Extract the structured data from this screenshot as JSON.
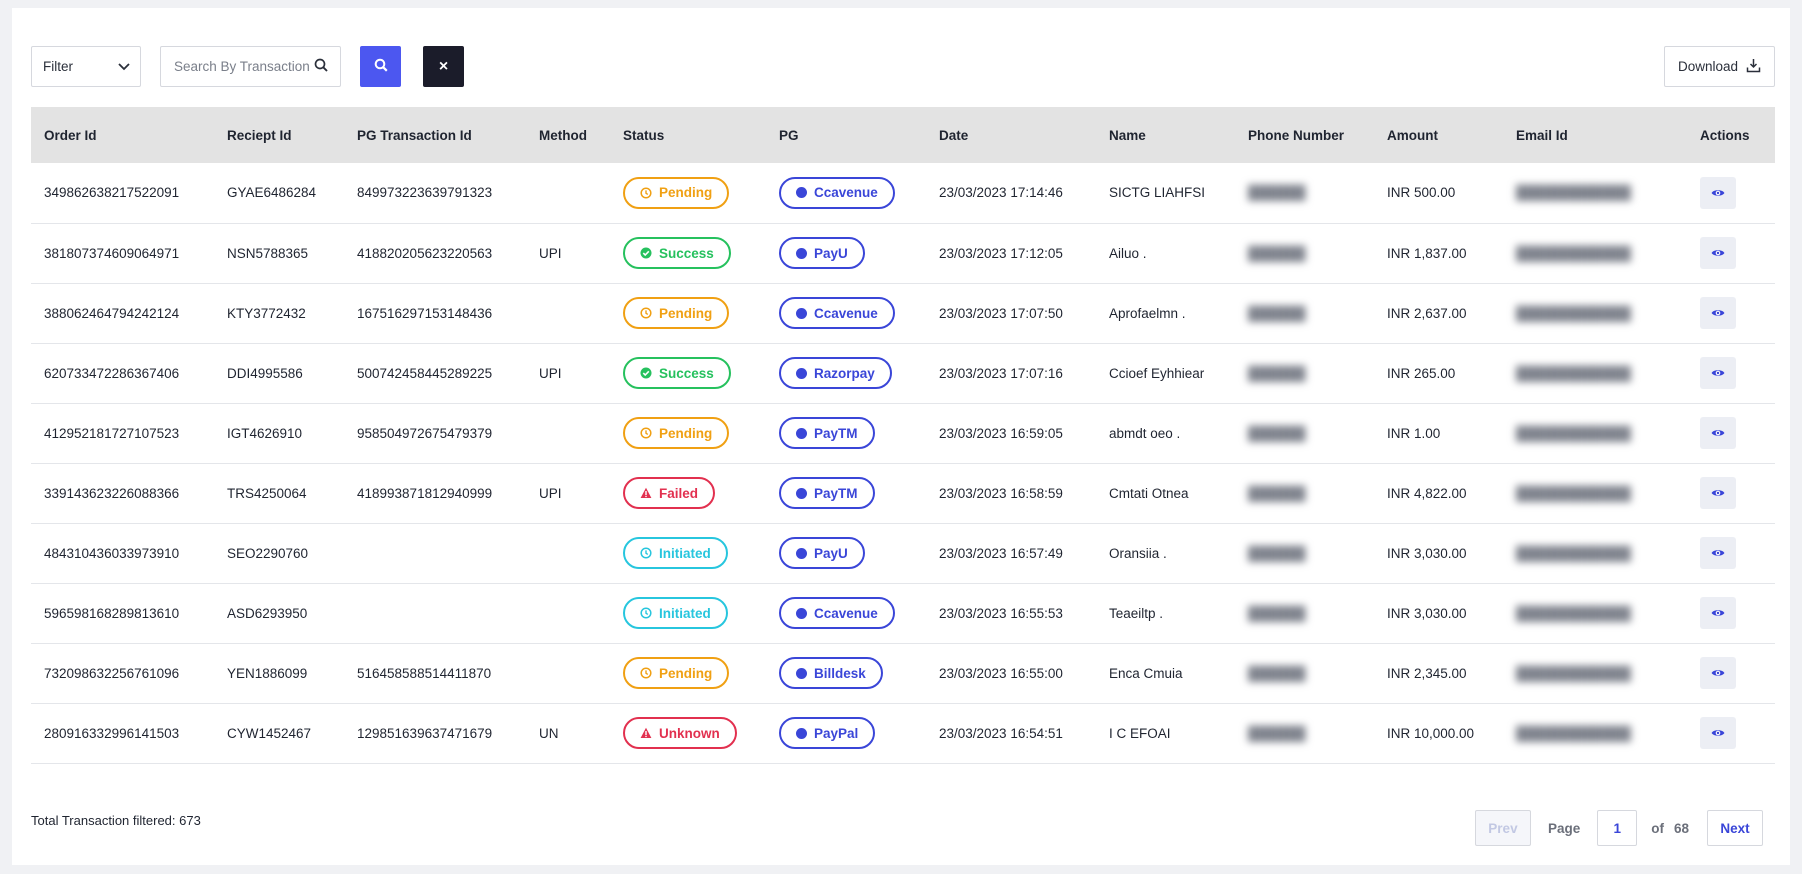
{
  "toolbar": {
    "filter_label": "Filter",
    "search_placeholder": "Search By Transaction",
    "clear_label": "×",
    "download_label": "Download"
  },
  "table": {
    "columns": [
      "Order Id",
      "Reciept Id",
      "PG Transaction Id",
      "Method",
      "Status",
      "PG",
      "Date",
      "Name",
      "Phone Number",
      "Amount",
      "Email Id",
      "Actions"
    ],
    "rows": [
      {
        "order_id": "349862638217522091",
        "receipt_id": "GYAE6486284",
        "pg_txn_id": "849973223639791323",
        "method": "",
        "status": "Pending",
        "status_kind": "pending",
        "pg": "Ccavenue",
        "date": "23/03/2023 17:14:46",
        "name": "SICTG LIAHFSI",
        "amount": "INR 500.00"
      },
      {
        "order_id": "381807374609064971",
        "receipt_id": "NSN5788365",
        "pg_txn_id": "418820205623220563",
        "method": "UPI",
        "status": "Success",
        "status_kind": "success",
        "pg": "PayU",
        "date": "23/03/2023 17:12:05",
        "name": "Ailuo .",
        "amount": "INR 1,837.00"
      },
      {
        "order_id": "388062464794242124",
        "receipt_id": "KTY3772432",
        "pg_txn_id": "167516297153148436",
        "method": "",
        "status": "Pending",
        "status_kind": "pending",
        "pg": "Ccavenue",
        "date": "23/03/2023 17:07:50",
        "name": "Aprofaelmn .",
        "amount": "INR 2,637.00"
      },
      {
        "order_id": "620733472286367406",
        "receipt_id": "DDI4995586",
        "pg_txn_id": "500742458445289225",
        "method": "UPI",
        "status": "Success",
        "status_kind": "success",
        "pg": "Razorpay",
        "date": "23/03/2023 17:07:16",
        "name": "Ccioef Eyhhiear",
        "amount": "INR 265.00"
      },
      {
        "order_id": "412952181727107523",
        "receipt_id": "IGT4626910",
        "pg_txn_id": "958504972675479379",
        "method": "",
        "status": "Pending",
        "status_kind": "pending",
        "pg": "PayTM",
        "date": "23/03/2023 16:59:05",
        "name": "abmdt oeo .",
        "amount": "INR 1.00"
      },
      {
        "order_id": "339143623226088366",
        "receipt_id": "TRS4250064",
        "pg_txn_id": "418993871812940999",
        "method": "UPI",
        "status": "Failed",
        "status_kind": "failed",
        "pg": "PayTM",
        "date": "23/03/2023 16:58:59",
        "name": "Cmtati Otnea",
        "amount": "INR 4,822.00"
      },
      {
        "order_id": "484310436033973910",
        "receipt_id": "SEO2290760",
        "pg_txn_id": "",
        "method": "",
        "status": "Initiated",
        "status_kind": "initiated",
        "pg": "PayU",
        "date": "23/03/2023 16:57:49",
        "name": "Oransiia .",
        "amount": "INR 3,030.00"
      },
      {
        "order_id": "596598168289813610",
        "receipt_id": "ASD6293950",
        "pg_txn_id": "",
        "method": "",
        "status": "Initiated",
        "status_kind": "initiated",
        "pg": "Ccavenue",
        "date": "23/03/2023 16:55:53",
        "name": "Teaeiltp .",
        "amount": "INR 3,030.00"
      },
      {
        "order_id": "732098632256761096",
        "receipt_id": "YEN1886099",
        "pg_txn_id": "516458588514411870",
        "method": "",
        "status": "Pending",
        "status_kind": "pending",
        "pg": "Billdesk",
        "date": "23/03/2023 16:55:00",
        "name": "Enca Cmuia",
        "amount": "INR 2,345.00"
      },
      {
        "order_id": "280916332996141503",
        "receipt_id": "CYW1452467",
        "pg_txn_id": "129851639637471679",
        "method": "UN",
        "status": "Unknown",
        "status_kind": "unknown",
        "pg": "PayPal",
        "date": "23/03/2023 16:54:51",
        "name": "I C EFOAI",
        "amount": "INR 10,000.00"
      }
    ]
  },
  "footer": {
    "total_text": "Total Transaction filtered: 673",
    "prev_label": "Prev",
    "page_label": "Page",
    "page_value": "1",
    "of_label": "of",
    "total_pages": "68",
    "next_label": "Next"
  },
  "colors": {
    "search_button": "#4c57f0",
    "clear_button": "#1b1c2a",
    "pending": "#f0a013",
    "success": "#26c15e",
    "failed": "#e2304f",
    "initiated": "#27c6de",
    "pg": "#3a46d8"
  }
}
